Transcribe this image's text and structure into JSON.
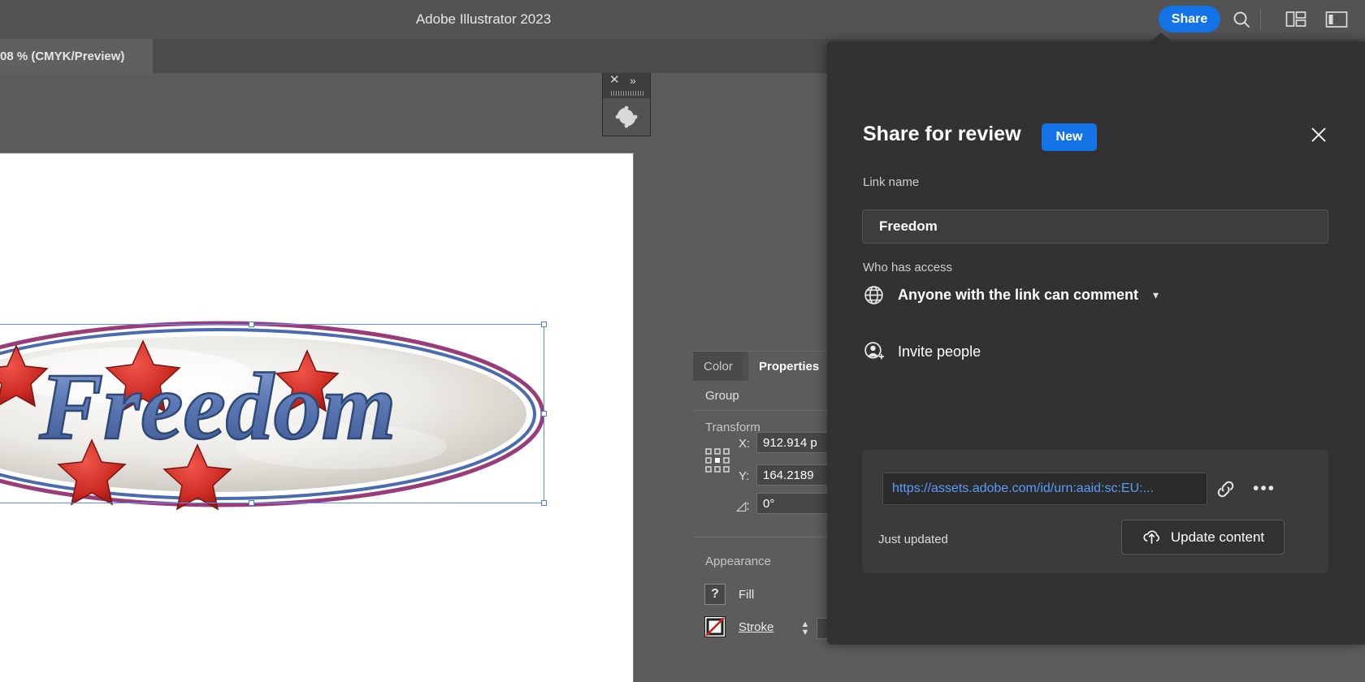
{
  "app": {
    "title": "Adobe Illustrator 2023"
  },
  "titlebar": {
    "share_label": "Share",
    "search_icon": "search-icon",
    "workspace_icon": "workspace-layout-icon",
    "panel_icon": "panel-toggle-icon"
  },
  "document_tab": {
    "label": "08 % (CMYK/Preview)"
  },
  "floating_panel": {
    "close_glyph": "✕",
    "collapse_glyph": "»",
    "tool_icon": "shaper-rotate-icon"
  },
  "properties_panel": {
    "tabs": [
      {
        "label": "Color",
        "active": false
      },
      {
        "label": "Properties",
        "active": true
      }
    ],
    "selection_type": "Group",
    "transform": {
      "section_label": "Transform",
      "x_label": "X:",
      "x_value": "912.914 p",
      "y_label": "Y:",
      "y_value": "164.2189",
      "angle_label": "◿:",
      "angle_value": "0°"
    },
    "appearance": {
      "section_label": "Appearance",
      "fill_label": "Fill",
      "fill_swatch": "unknown-question-swatch",
      "stroke_label": "Stroke",
      "stroke_swatch": "none-stroke-swatch"
    }
  },
  "share_popover": {
    "title": "Share for review",
    "badge": "New",
    "close_icon": "close-icon",
    "link_name_label": "Link name",
    "link_name_value": "Freedom",
    "access_label": "Who has access",
    "access_value": "Anyone with the link can comment",
    "access_icon": "globe-icon",
    "access_caret": "chevron-down-icon",
    "invite_label": "Invite people",
    "invite_icon": "add-person-icon",
    "link_url": "https://assets.adobe.com/id/urn:aaid:sc:EU:...",
    "copy_link_icon": "link-chain-icon",
    "more_options": "•••",
    "status_text": "Just updated",
    "update_button_label": "Update content",
    "update_button_icon": "cloud-upload-icon"
  },
  "artwork": {
    "text": "Freedom",
    "description": "ellipse-logo-with-stars"
  },
  "colors": {
    "accent_blue": "#1473e6",
    "link_blue": "#5a9cf8",
    "panel_bg": "#323232",
    "app_bg": "#535353",
    "canvas_bg": "#5c5c5c",
    "selection_blue": "#5b8ff9"
  }
}
